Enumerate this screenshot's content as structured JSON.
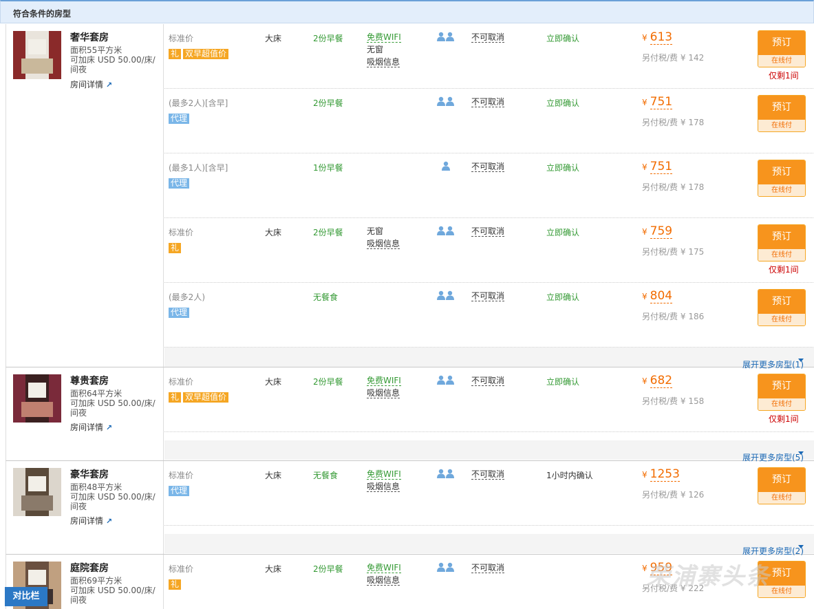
{
  "section_title": "符合条件的房型",
  "compare_label": "对比栏",
  "watermark": "荣浦寨头条",
  "detail_label": "房间详情",
  "book_label": "预订",
  "online_label": "在线付",
  "tax_prefix": "另付税/费 ¥",
  "yen": "¥",
  "rooms": [
    {
      "name": "奢华套房",
      "area": "面积55平方米",
      "extra": "可加床 USD 50.00/床/间夜",
      "expand": "展开更多房型(1)",
      "plans": [
        {
          "name": "标准价",
          "bed": "大床",
          "meal": "2份早餐",
          "wifi": "免费WIFI",
          "window": "无窗",
          "smoke": "吸烟信息",
          "cancel": "不可取消",
          "confirm": "立即确认",
          "price": "613",
          "tax": "142",
          "badges": [
            "礼",
            "双早超值价"
          ],
          "left": "仅剩1间"
        },
        {
          "name": "(最多2人)[含早]",
          "bed": "",
          "meal": "2份早餐",
          "wifi": "",
          "window": "",
          "smoke": "",
          "cancel": "不可取消",
          "confirm": "立即确认",
          "price": "751",
          "tax": "178",
          "badges": [
            "代理"
          ],
          "left": ""
        },
        {
          "name": "(最多1人)[含早]",
          "bed": "",
          "meal": "1份早餐",
          "wifi": "",
          "window": "",
          "smoke": "",
          "cancel": "不可取消",
          "confirm": "立即确认",
          "price": "751",
          "tax": "178",
          "badges": [
            "代理"
          ],
          "left": ""
        },
        {
          "name": "标准价",
          "bed": "大床",
          "meal": "2份早餐",
          "wifi": "",
          "window": "无窗",
          "smoke": "吸烟信息",
          "cancel": "不可取消",
          "confirm": "立即确认",
          "price": "759",
          "tax": "175",
          "badges": [
            "礼"
          ],
          "left": "仅剩1间"
        },
        {
          "name": "(最多2人)",
          "bed": "",
          "meal": "无餐食",
          "wifi": "",
          "window": "",
          "smoke": "",
          "cancel": "不可取消",
          "confirm": "立即确认",
          "price": "804",
          "tax": "186",
          "badges": [
            "代理"
          ],
          "left": ""
        }
      ]
    },
    {
      "name": "尊贵套房",
      "area": "面积64平方米",
      "extra": "可加床 USD 50.00/床/间夜",
      "expand": "展开更多房型(5)",
      "plans": [
        {
          "name": "标准价",
          "bed": "大床",
          "meal": "2份早餐",
          "wifi": "免费WIFI",
          "window": "",
          "smoke": "吸烟信息",
          "cancel": "不可取消",
          "confirm": "立即确认",
          "price": "682",
          "tax": "158",
          "badges": [
            "礼",
            "双早超值价"
          ],
          "left": "仅剩1间"
        }
      ]
    },
    {
      "name": "豪华套房",
      "area": "面积48平方米",
      "extra": "可加床 USD 50.00/床/间夜",
      "expand": "展开更多房型(2)",
      "plans": [
        {
          "name": "标准价",
          "bed": "大床",
          "meal": "无餐食",
          "wifi": "免费WIFI",
          "window": "",
          "smoke": "吸烟信息",
          "cancel": "不可取消",
          "confirm": "1小时内确认",
          "price": "1253",
          "tax": "126",
          "badges": [
            "代理"
          ],
          "left": ""
        }
      ]
    },
    {
      "name": "庭院套房",
      "area": "面积69平方米",
      "extra": "可加床 USD 50.00/床/间夜",
      "expand": "",
      "plans": [
        {
          "name": "标准价",
          "bed": "大床",
          "meal": "2份早餐",
          "wifi": "免费WIFI",
          "window": "",
          "smoke": "吸烟信息",
          "cancel": "不可取消",
          "confirm": "",
          "price": "959",
          "tax": "222",
          "badges": [
            "礼"
          ],
          "left": ""
        }
      ]
    }
  ]
}
